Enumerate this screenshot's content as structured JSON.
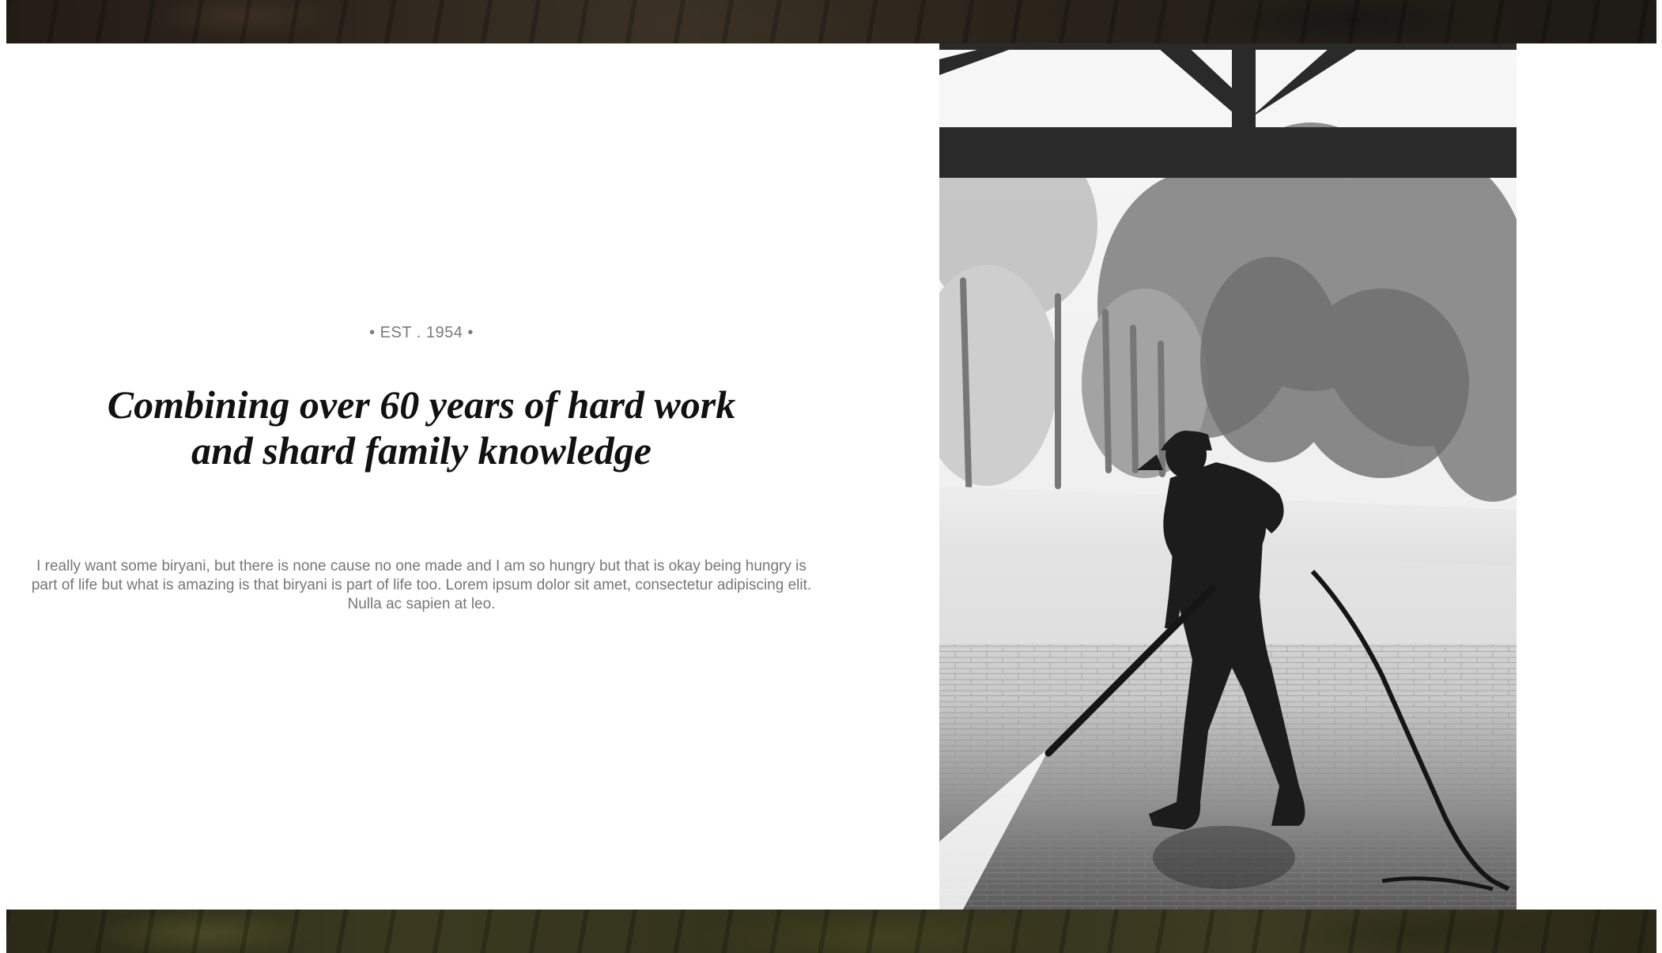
{
  "hero": {
    "est_label": "• EST . 1954 •",
    "heading_line1": "Combining over 60 years of hard work",
    "heading_line2": "and shard family knowledge",
    "body": "I really want some biryani, but there is none cause no one made and I am so hungry but that is okay being hungry is part of life but what is amazing is that biryani is part of life too. Lorem ipsum dolor sit amet, consectetur adipiscing elit. Nulla ac sapien at leo."
  },
  "photo": {
    "subject": "worker-pressure-washing-photo"
  },
  "colors": {
    "heading": "#111111",
    "muted_text": "#777777",
    "background": "#ffffff"
  }
}
